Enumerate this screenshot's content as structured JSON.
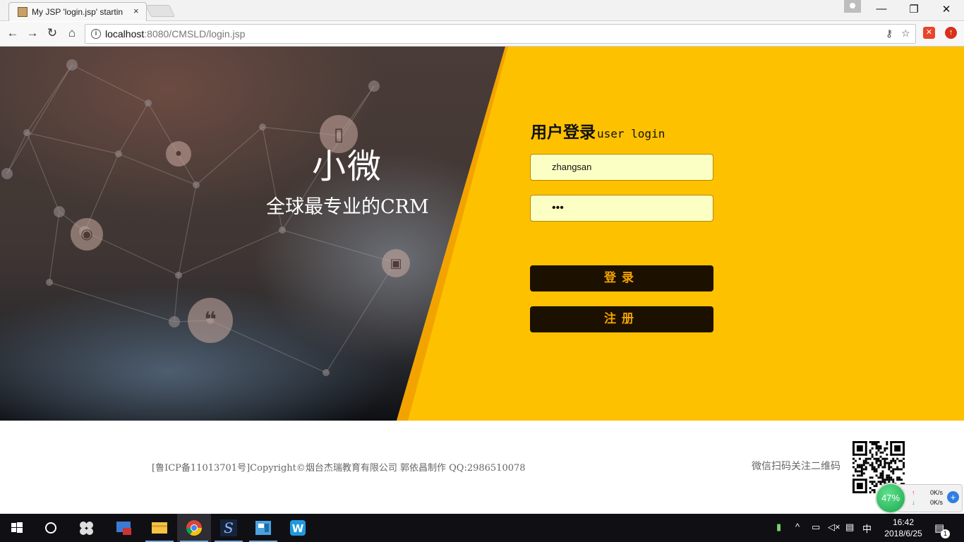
{
  "browser": {
    "tab_title": "My JSP 'login.jsp' startin",
    "close_glyph": "×",
    "url_host": "localhost",
    "url_rest": ":8080/CMSLD/login.jsp",
    "window_buttons": [
      "—",
      "❐",
      "✕"
    ]
  },
  "hero": {
    "brand": "小微",
    "slogan": "全球最专业的CRM"
  },
  "login": {
    "title": "用户登录",
    "subtitle": "user login",
    "username_value": "zhangsan",
    "password_value": "•••",
    "login_button": "登录",
    "register_button": "注册"
  },
  "footer": {
    "copyright": "[鲁ICP备11013701号]Copyright©烟台杰瑞教育有限公司 郭依昌制作 QQ:2986510078",
    "wechat_text": "微信扫码关注二维码"
  },
  "speed_widget": {
    "percent": "47%",
    "upload": "0K/s",
    "download": "0K/s"
  },
  "taskbar": {
    "ime": "中",
    "time": "16:42",
    "date": "2018/6/25",
    "notifications": "1"
  },
  "colors": {
    "accent_yellow": "#fdc100",
    "button_bg": "#1c1100",
    "button_text": "#f3a300"
  }
}
